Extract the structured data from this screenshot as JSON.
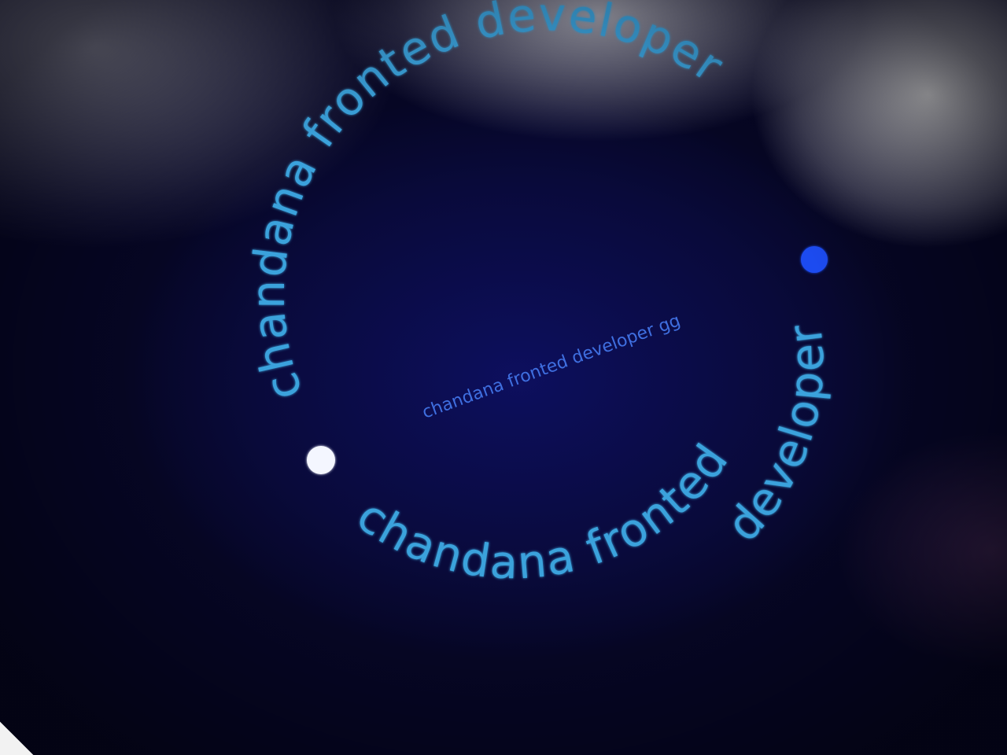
{
  "badge": {
    "ring_text_top": "chandana fronted developer",
    "ring_text_right": "developer",
    "ring_text_bottom": "chandana fronted developer",
    "center_text": "chandana fronted developer gg",
    "colors": {
      "background": "#0a0a2e",
      "ring_text": "#3aa2dc",
      "center_text": "#3f6fe0",
      "dot_left": "#f4f6ff",
      "dot_right": "#1e4bf0"
    }
  }
}
